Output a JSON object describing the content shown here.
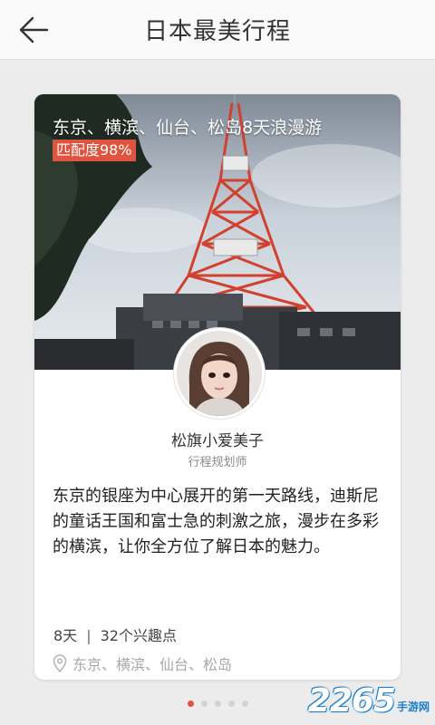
{
  "header": {
    "title": "日本最美行程"
  },
  "card": {
    "trip_title": "东京、横滨、仙台、松岛8天浪漫游",
    "match_badge": "匹配度98%",
    "author_name": "松旗小爱美子",
    "author_role": "行程规划师",
    "description": "东京的银座为中心展开的第一天路线，迪斯尼的童话王国和富士急的刺激之旅，漫步在多彩的横滨，让你全方位了解日本的魅力。",
    "days": "8天",
    "separator": "|",
    "poi_count": "32个兴趣点",
    "cities": "东京、横滨、仙台、松岛"
  },
  "pager": {
    "total": 5,
    "active_index": 0
  },
  "watermark": {
    "number": "2265",
    "text": "手游网"
  },
  "colors": {
    "accent": "#e0533e",
    "background": "#ececec",
    "tower": "#d2402e"
  }
}
